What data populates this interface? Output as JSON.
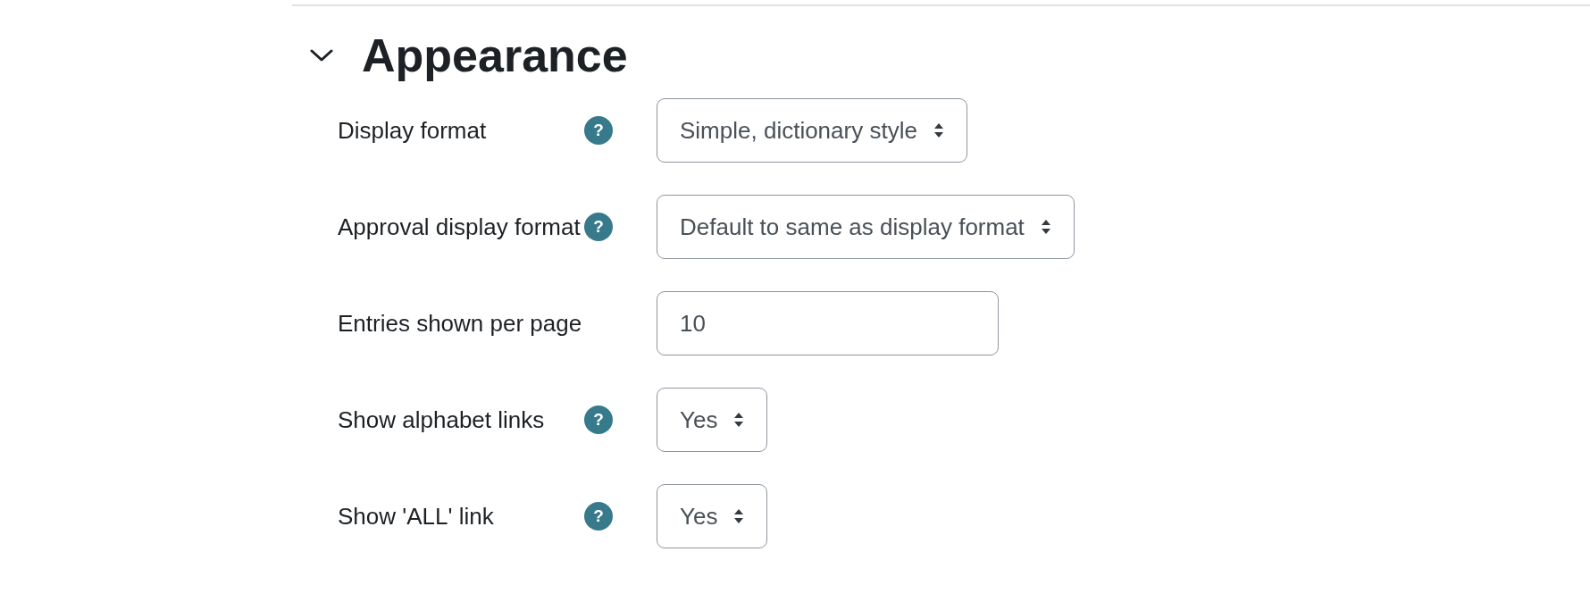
{
  "section": {
    "title": "Appearance",
    "expanded": true
  },
  "fields": [
    {
      "label": "Display format",
      "help_icon": "?",
      "kind": "select",
      "value": "Simple, dictionary style"
    },
    {
      "label": "Approval display format",
      "help_icon": "?",
      "kind": "select",
      "value": "Default to same as display format"
    },
    {
      "label": "Entries shown per page",
      "kind": "text",
      "value": "10"
    },
    {
      "label": "Show alphabet links",
      "help_icon": "?",
      "kind": "select",
      "value": "Yes"
    },
    {
      "label": "Show 'ALL' link",
      "help_icon": "?",
      "kind": "select",
      "value": "Yes"
    }
  ]
}
